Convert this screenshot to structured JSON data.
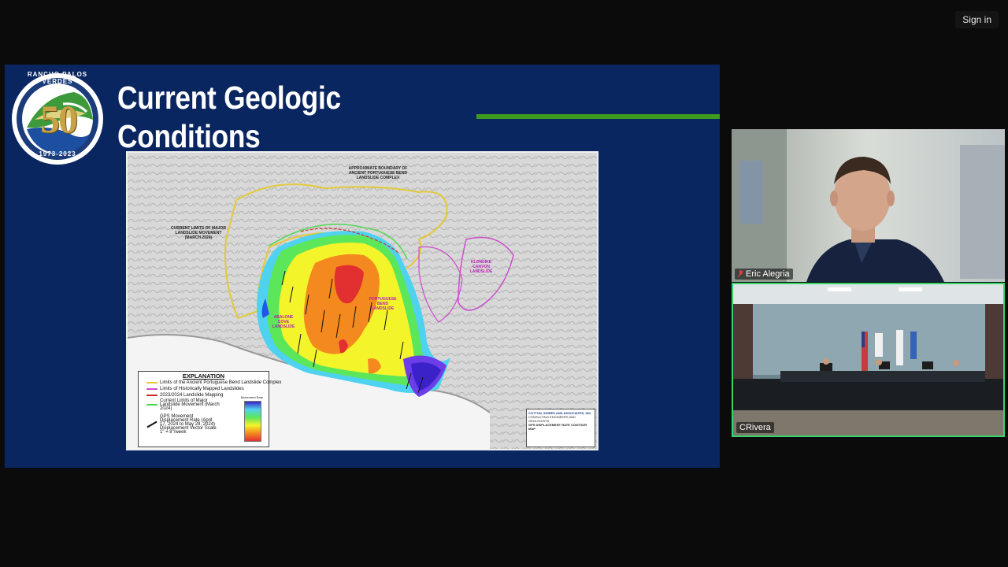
{
  "topbar": {
    "signin_label": "Sign in"
  },
  "slide": {
    "title_line1": "Current Geologic",
    "title_line2": "Conditions",
    "logo": {
      "arc_text_top": "RANCHO PALOS VERDES",
      "number": "50",
      "years": "1973-2023"
    },
    "map": {
      "label_boundary": "APPROXIMATE BOUNDARY OF ANCIENT PORTUGUESE BEND LANDSLIDE COMPLEX",
      "label_limits": "CURRENT LIMITS OF MAJOR LANDSLIDE MOVEMENT (MARCH 2024)",
      "label_portuguese": "PORTUGUESE BEND LANDSLIDE",
      "label_abalone": "ABALONE COVE LANDSLIDE",
      "label_klondike": "KLONDIKE CANYON LANDSLIDE",
      "explanation": {
        "title": "EXPLANATION",
        "items": [
          {
            "label": "Limits of the Ancient Portuguese Bend Landslide Complex",
            "color": "#e3c93a"
          },
          {
            "label": "Limits of Historically Mapped Landslides",
            "color": "#c94fc9"
          },
          {
            "label": "2023/2024 Landslide Mapping",
            "color": "#d22a2a"
          },
          {
            "label": "Current Limits of Major Landslide Movement (March 2024)",
            "color": "#55d655"
          },
          {
            "label": "GPS Movement Displacement Rate (April 17, 2024 to May 29, 2024) Displacement Vector Scale 1\" = 8\"/week",
            "color": "#111111"
          }
        ],
        "scale_title": "Movement Rate"
      },
      "titleblock_firm": "COTTON, SHIRES AND ASSOCIATES, INC.",
      "titleblock_sub": "CONSULTING ENGINEERS AND GEOLOGISTS",
      "titleblock_title": "GPS DISPLACEMENT RATE CONTOUR MAP"
    }
  },
  "participants": [
    {
      "name": "Eric Alegria",
      "muted": true
    },
    {
      "name": "CRivera",
      "muted": false,
      "active_speaker": true
    }
  ],
  "colors": {
    "slide_bg": "#0a2660",
    "accent_green": "#3e9b1e",
    "active_speaker_border": "#38d56c"
  }
}
